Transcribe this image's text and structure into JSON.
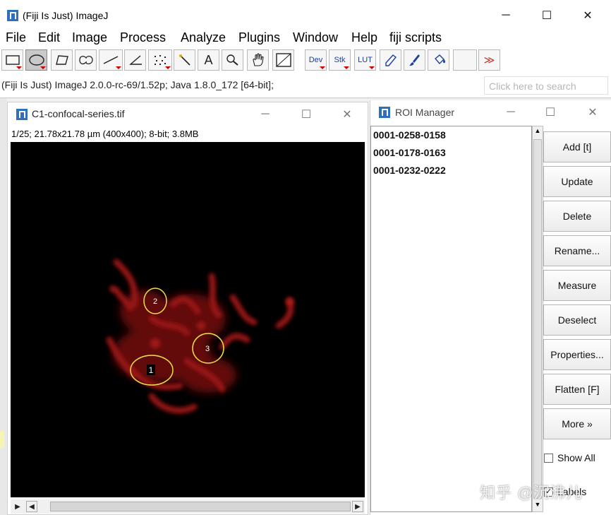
{
  "main_window": {
    "title": "(Fiji Is Just) ImageJ",
    "menus": [
      "File",
      "Edit",
      "Image",
      "Process",
      "Analyze",
      "Plugins",
      "Window",
      "Help",
      "fiji scripts"
    ],
    "tool_labels": {
      "dev": "Dev",
      "stk": "Stk",
      "lut": "LUT",
      "text": "A",
      "more": "≫"
    },
    "status": "(Fiji Is Just) ImageJ 2.0.0-rc-69/1.52p; Java 1.8.0_172 [64-bit];",
    "search_placeholder": "Click here to search",
    "window_controls": {
      "minimize": "─",
      "maximize": "☐",
      "close": "✕"
    }
  },
  "image_window": {
    "title": "C1-confocal-series.tif",
    "info": "1/25; 21.78x21.78 µm (400x400); 8-bit; 3.8MB",
    "rois": [
      {
        "label": "1"
      },
      {
        "label": "2"
      },
      {
        "label": "3"
      }
    ]
  },
  "roi_manager": {
    "title": "ROI Manager",
    "items": [
      "0001-0258-0158",
      "0001-0178-0163",
      "0001-0232-0222"
    ],
    "buttons": [
      "Add [t]",
      "Update",
      "Delete",
      "Rename...",
      "Measure",
      "Deselect",
      "Properties...",
      "Flatten [F]",
      "More »"
    ],
    "checkboxes": [
      {
        "label": "Show All",
        "checked": false
      },
      {
        "label": "Labels",
        "checked": true
      }
    ]
  },
  "watermark": "知乎 @沉沸儿",
  "colors": {
    "roi_outline": "#e8e04a",
    "signal": "#8a0f0f",
    "accent_icon": "#2f6fbd"
  }
}
